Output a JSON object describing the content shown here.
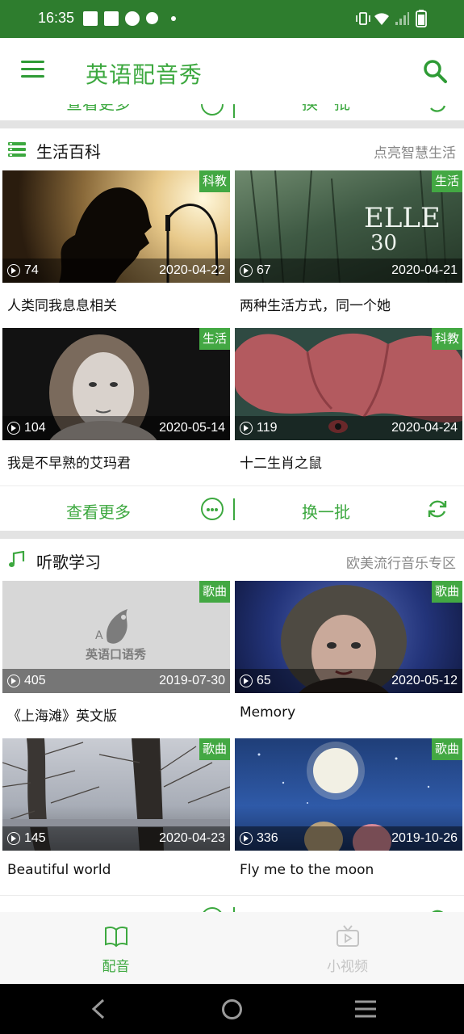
{
  "status_bar": {
    "time": "16:35"
  },
  "app_bar": {
    "title": "英语配音秀"
  },
  "colors": {
    "primary": "#2e7d2e",
    "accent": "#3ca83f",
    "tag_bg": "#43a843"
  },
  "sections": [
    {
      "title": "生活百科",
      "subtitle": "点亮智慧生活",
      "icon": "list-icon",
      "items": [
        {
          "tag": "科教",
          "views": "74",
          "date": "2020-04-22",
          "title": "人类同我息息相关"
        },
        {
          "tag": "生活",
          "views": "67",
          "date": "2020-04-21",
          "title": "两种生活方式，同一个她"
        },
        {
          "tag": "生活",
          "views": "104",
          "date": "2020-05-14",
          "title": "我是不早熟的艾玛君"
        },
        {
          "tag": "科教",
          "views": "119",
          "date": "2020-04-24",
          "title": "十二生肖之鼠"
        }
      ],
      "more_label": "查看更多",
      "refresh_label": "换一批"
    },
    {
      "title": "听歌学习",
      "subtitle": "欧美流行音乐专区",
      "icon": "music-note-icon",
      "items": [
        {
          "tag": "歌曲",
          "views": "405",
          "date": "2019-07-30",
          "title": "《上海滩》英文版",
          "placeholder_logo": "英语口语秀"
        },
        {
          "tag": "歌曲",
          "views": "65",
          "date": "2020-05-12",
          "title": "Memory"
        },
        {
          "tag": "歌曲",
          "views": "145",
          "date": "2020-04-23",
          "title": "Beautiful world"
        },
        {
          "tag": "歌曲",
          "views": "336",
          "date": "2019-10-26",
          "title": "Fly me to the moon"
        }
      ]
    }
  ],
  "bottom_nav": [
    {
      "label": "配音",
      "icon": "book-icon",
      "active": true
    },
    {
      "label": "小视频",
      "icon": "tv-icon",
      "active": false
    }
  ]
}
